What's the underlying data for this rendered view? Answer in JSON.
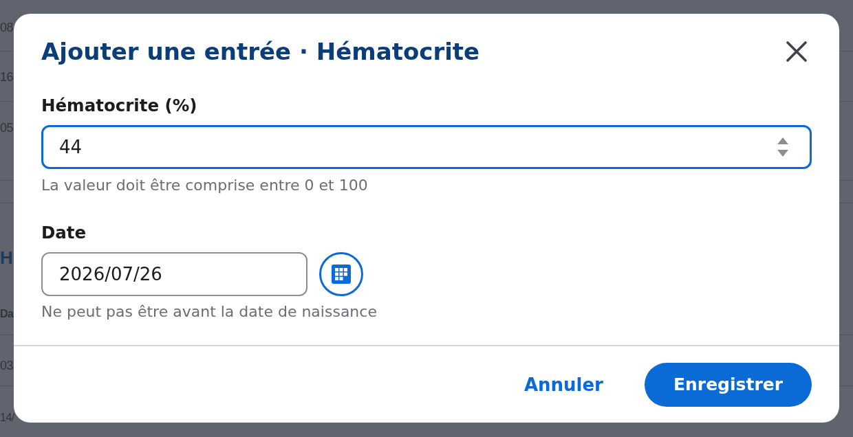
{
  "background_page": {
    "table_1_rows": [
      {
        "column_1": "08"
      },
      {
        "column_1": "16"
      },
      {
        "column_1": "05"
      }
    ],
    "section_heading": "H",
    "table_2_columns": [
      "Da"
    ],
    "table_2_rows": [
      {
        "column_1": "03"
      },
      {
        "column_1": "14/"
      }
    ]
  },
  "dialog": {
    "title": "Ajouter une entrée · Hématocrite",
    "fields": [
      {
        "kind": "number",
        "label": "Hématocrite (%)",
        "value": "44",
        "focused": true,
        "help": "La valeur doit être comprise entre 0 et 100"
      },
      {
        "kind": "date",
        "label": "Date",
        "value": "2026/07/26",
        "focused": false,
        "help": "Ne peut pas être avant la date de naissance"
      }
    ],
    "buttons": [
      {
        "kind": "link",
        "label": "Annuler"
      },
      {
        "kind": "primary",
        "label": "Enregistrer"
      }
    ]
  }
}
